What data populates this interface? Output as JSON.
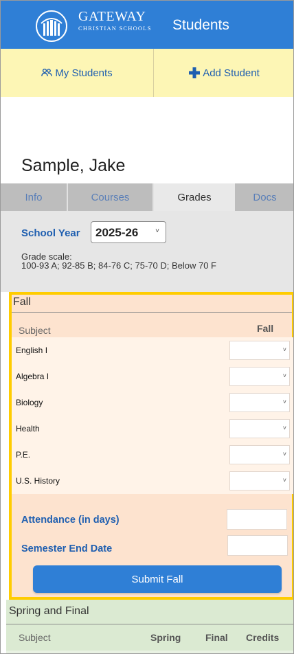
{
  "header": {
    "brand_name": "GATEWAY",
    "brand_sub": "CHRISTIAN SCHOOLS",
    "title": "Students"
  },
  "nav": {
    "my_students": "My Students",
    "add_student": "Add Student"
  },
  "student": {
    "name": "Sample, Jake"
  },
  "tabs": [
    {
      "label": "Info",
      "active": false
    },
    {
      "label": "Courses",
      "active": false
    },
    {
      "label": "Grades",
      "active": true
    },
    {
      "label": "Docs",
      "active": false
    }
  ],
  "school_year": {
    "label": "School Year",
    "value": "2025-26"
  },
  "grade_scale": {
    "title": "Grade scale:",
    "text": "100-93 A;  92-85 B;  84-76 C; 75-70 D;  Below 70 F"
  },
  "fall": {
    "title": "Fall",
    "col_subject": "Subject",
    "col_fall": "Fall",
    "subjects": [
      {
        "name": "English I",
        "grade": ""
      },
      {
        "name": "Algebra I",
        "grade": ""
      },
      {
        "name": "Biology",
        "grade": ""
      },
      {
        "name": "Health",
        "grade": ""
      },
      {
        "name": "P.E.",
        "grade": ""
      },
      {
        "name": "U.S. History",
        "grade": ""
      }
    ],
    "attendance_label": "Attendance (in days)",
    "attendance_value": "",
    "end_date_label": "Semester End Date",
    "end_date_value": "",
    "submit_label": "Submit Fall"
  },
  "spring": {
    "title": "Spring and Final",
    "col_subject": "Subject",
    "col_spring": "Spring",
    "col_final": "Final",
    "col_credits": "Credits"
  },
  "colors": {
    "brand_blue": "#2f7fd6",
    "nav_yellow": "#fdf6b5",
    "fall_bg": "#fde3cf",
    "fall_border": "#ffcc00",
    "spring_bg": "#dbead2",
    "label_blue": "#1f5fb0"
  }
}
